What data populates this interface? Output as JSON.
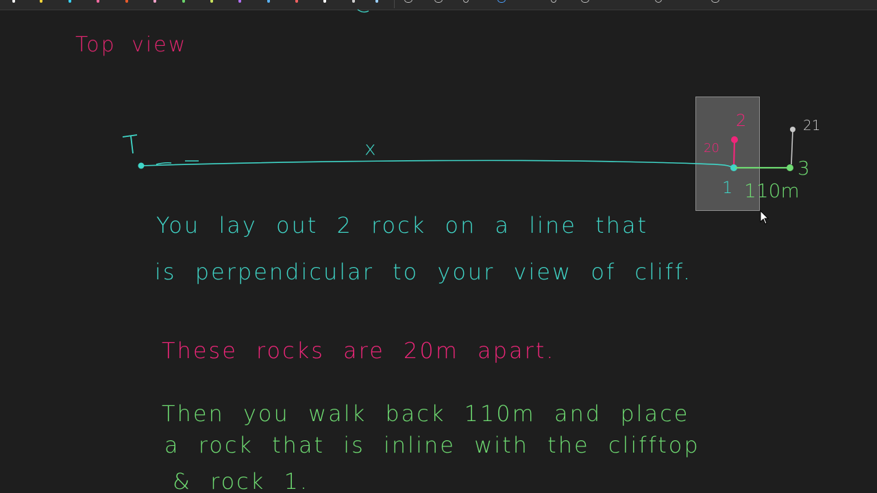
{
  "toolbar": {
    "pen_colors": [
      "#f3f3f3",
      "#f2d43a",
      "#f06aa0",
      "#3ad0f0",
      "#e85a2b",
      "#f0a0c8",
      "#6bd46b",
      "#c7e05b",
      "#b070f0",
      "#5ab0f0",
      "#f06060",
      "#ffffff"
    ],
    "icons": [
      "undo-icon",
      "redo-icon",
      "lasso-icon",
      "eraser-icon",
      "text-icon",
      "pen-icon",
      "shapes-icon",
      "download-icon"
    ]
  },
  "canvas": {
    "heading": "Top view",
    "diagram": {
      "label_T": "T",
      "label_x": "x",
      "label_2": "2",
      "label_20": "20",
      "label_1": "1",
      "label_110m": "110m",
      "label_21": "21",
      "label_3": "3",
      "colors": {
        "main_line": "#40d6c8",
        "rock2": "#f0267a",
        "walk_line": "#6fdc72",
        "grey_marker": "#c8c8c8"
      }
    },
    "notes": {
      "line1": "You lay out 2 rock on a line that",
      "line2": "is perpendicular to your view of cliff.",
      "line3": "These rocks are 20m apart.",
      "line4": "Then you walk back 110m and place",
      "line5": "a rock that is inline with the clifftop",
      "line6": "& rock 1."
    }
  }
}
